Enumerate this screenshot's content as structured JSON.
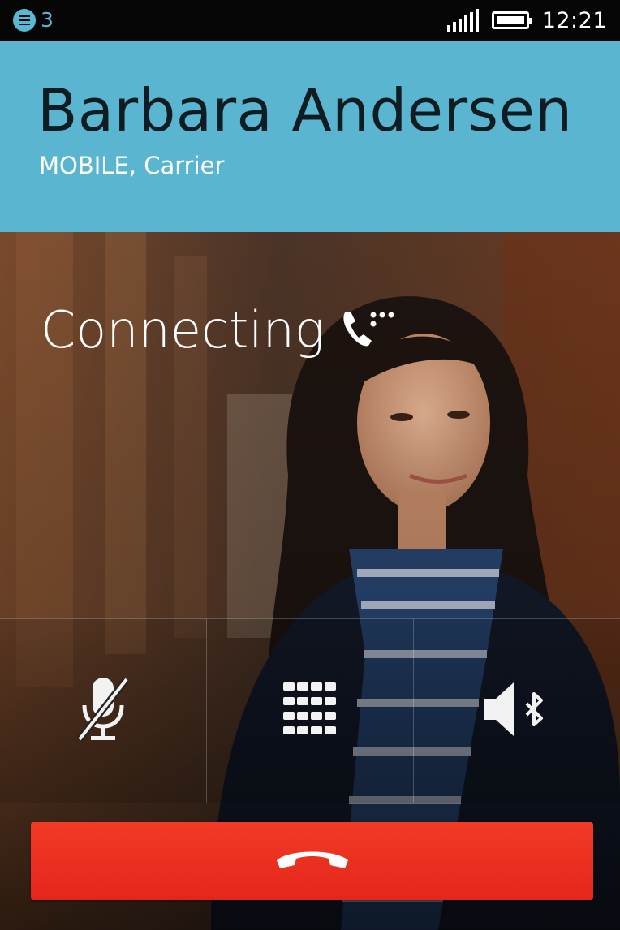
{
  "status_bar": {
    "notification_icon": "notification-list-icon",
    "notification_count": "3",
    "signal_icon": "signal-bars-icon",
    "battery_icon": "battery-icon",
    "battery_level": 1.0,
    "time": "12:21"
  },
  "call": {
    "contact_name": "Barbara Andersen",
    "number_type": "MOBILE, Carrier",
    "status": "Connecting",
    "status_icon": "phone-outgoing-icon",
    "header_color": "#5ab5d0"
  },
  "controls": {
    "mute_icon": "microphone-muted-icon",
    "keypad_icon": "dialpad-icon",
    "speaker_icon": "speaker-bluetooth-icon"
  },
  "hangup": {
    "icon": "hang-up-phone-icon",
    "color": "#e8291c"
  }
}
